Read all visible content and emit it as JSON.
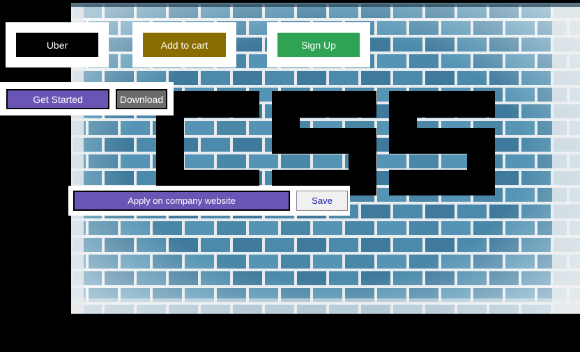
{
  "buttons": {
    "uber": "Uber",
    "add_to_cart": "Add to cart",
    "sign_up": "Sign Up",
    "get_started": "Get Started",
    "download": "Download",
    "apply": "Apply on company website",
    "save": "Save"
  },
  "background": {
    "logo_text": "CSS",
    "brick_color": "#4a88a8",
    "mortar_color": "#e8eef0"
  },
  "colors": {
    "uber_bg": "#000000",
    "add_to_cart_bg": "#8a6d00",
    "sign_up_bg": "#2ea354",
    "get_started_bg": "#6a54b4",
    "download_bg": "#6b6b6b",
    "apply_bg": "#6a54b4",
    "save_bg": "#f0f0f0"
  }
}
